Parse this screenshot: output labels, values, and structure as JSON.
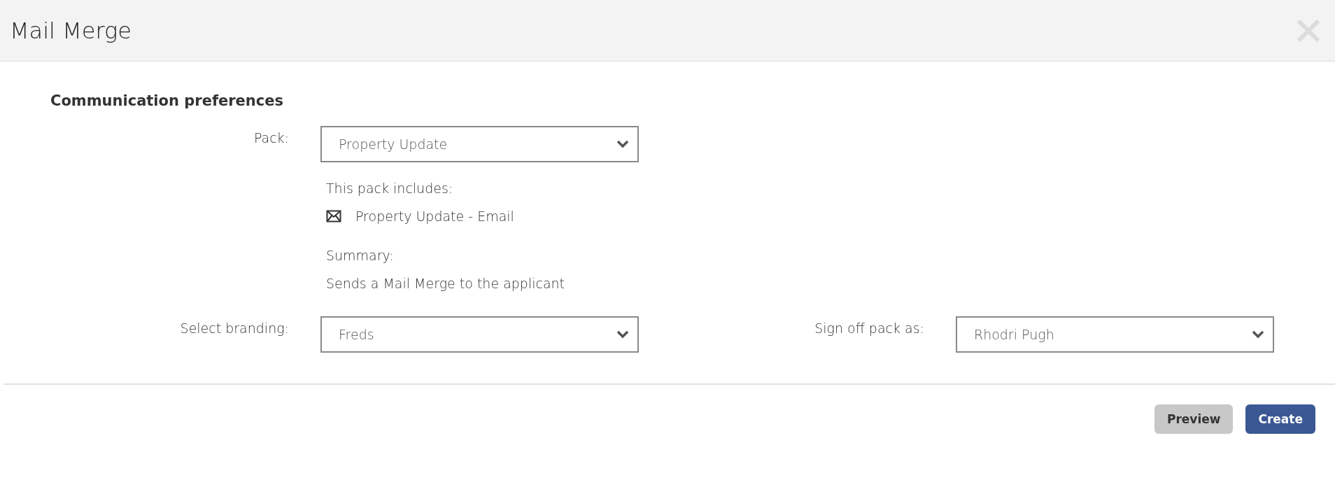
{
  "window": {
    "title": "Mail Merge"
  },
  "section": {
    "title": "Communication preferences"
  },
  "pack": {
    "label": "Pack:",
    "value": "Property Update"
  },
  "pack_details": {
    "includes_label": "This pack includes:",
    "items": [
      {
        "kind": "email",
        "label": "Property Update - Email"
      }
    ],
    "summary_label": "Summary:",
    "summary": "Sends a Mail Merge to the applicant"
  },
  "branding": {
    "label": "Select branding:",
    "value": "Freds"
  },
  "sign_off": {
    "label": "Sign off pack as:",
    "value": "Rhodri Pugh"
  },
  "buttons": [
    {
      "kind": "secondary",
      "label": "Preview"
    },
    {
      "kind": "primary",
      "label": "Create"
    }
  ]
}
